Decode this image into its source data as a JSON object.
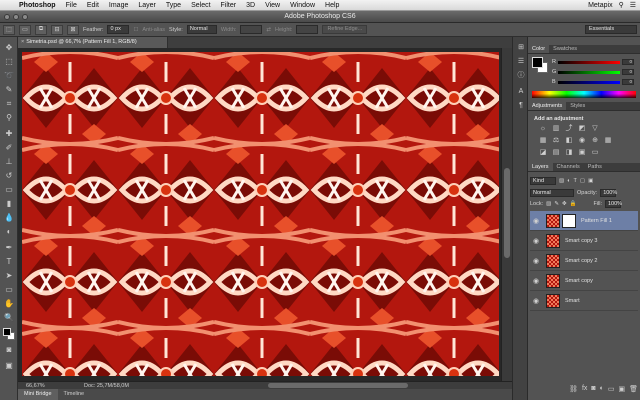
{
  "menubar": {
    "items": [
      "Photoshop",
      "File",
      "Edit",
      "Image",
      "Layer",
      "Type",
      "Select",
      "Filter",
      "3D",
      "View",
      "Window",
      "Help"
    ],
    "user": "Metapix"
  },
  "window": {
    "title": "Adobe Photoshop CS6"
  },
  "options": {
    "feather_label": "Feather:",
    "feather_value": "0 px",
    "antialias_label": "Anti-alias",
    "style_label": "Style:",
    "style_value": "Normal",
    "width_label": "Width:",
    "height_label": "Height:",
    "refine_label": "Refine Edge...",
    "workspace": "Essentials"
  },
  "document": {
    "tab_title": "Simetria.psd @ 66,7% (Pattern Fill 1, RGB/8)",
    "zoom": "66,67%",
    "doc_size": "Doc: 25,7M/58,0M"
  },
  "bottom_tabs": [
    "Mini Bridge",
    "Timeline"
  ],
  "color_panel": {
    "tabs": [
      "Color",
      "Swatches"
    ],
    "channels": [
      {
        "label": "R",
        "value": "0"
      },
      {
        "label": "G",
        "value": "0"
      },
      {
        "label": "B",
        "value": "0"
      }
    ],
    "foreground": "#000000",
    "background": "#ffffff"
  },
  "adjustments_panel": {
    "tabs": [
      "Adjustments",
      "Styles"
    ],
    "title": "Add an adjustment"
  },
  "layers_panel": {
    "tabs": [
      "Layers",
      "Channels",
      "Paths"
    ],
    "filter_kind": "Kind",
    "blend_mode": "Normal",
    "opacity_label": "Opacity:",
    "opacity_value": "100%",
    "lock_label": "Lock:",
    "fill_label": "Fill:",
    "fill_value": "100%",
    "layers": [
      {
        "name": "Pattern Fill 1",
        "active": true
      },
      {
        "name": "Smart copy 3",
        "active": false
      },
      {
        "name": "Smart copy 2",
        "active": false
      },
      {
        "name": "Smart copy",
        "active": false
      },
      {
        "name": "Smart",
        "active": false
      }
    ]
  },
  "colors": {
    "pattern_dark": "#7a0c06",
    "pattern_mid": "#c8240f",
    "pattern_light": "#ffd9c4",
    "layer_selected": "#6d7fa6"
  }
}
